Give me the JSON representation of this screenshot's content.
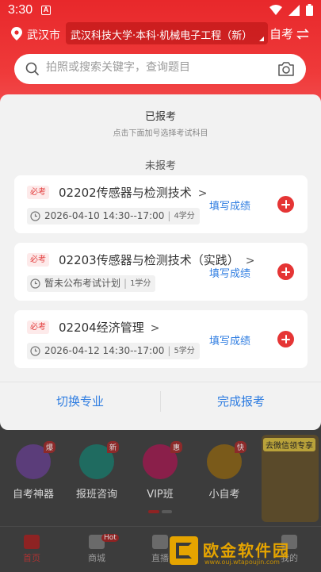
{
  "status_bar": {
    "time": "3:30",
    "a_icon": "A",
    "icons": [
      "wifi-icon",
      "signal-icon",
      "battery-icon"
    ]
  },
  "header": {
    "city": "武汉市",
    "major": "武汉科技大学·本科·机械电子工程（新）",
    "exam_type": "自考",
    "search_placeholder": "拍照或搜索关键字，查询题目"
  },
  "sheet": {
    "registered_title": "已报考",
    "registered_hint": "点击下面加号选择考试科目",
    "unregistered_title": "未报考",
    "courses": [
      {
        "tag": "必考",
        "name": "02202传感器与检测技术",
        "chevron": ">",
        "schedule": "2026-04-10 14:30--17:00",
        "credits": "4学分",
        "fill_label": "填写成绩"
      },
      {
        "tag": "必考",
        "name": "02203传感器与检测技术（实践）",
        "chevron": ">",
        "schedule": "暂未公布考试计划",
        "credits": "1学分",
        "fill_label": "填写成绩"
      },
      {
        "tag": "必考",
        "name": "02204经济管理",
        "chevron": ">",
        "schedule": "2026-04-12 14:30--17:00",
        "credits": "5学分",
        "fill_label": "填写成绩"
      }
    ],
    "switch_major_label": "切换专业",
    "done_label": "完成报考"
  },
  "background": {
    "features": [
      {
        "label": "自考神器",
        "badge": "爆",
        "color": "#5b3d7a"
      },
      {
        "label": "报班咨询",
        "badge": "新",
        "color": "#1f6b60"
      },
      {
        "label": "VIP班",
        "badge": "惠",
        "color": "#8a1f4a"
      },
      {
        "label": "小自考",
        "badge": "快",
        "color": "#7a5a1a"
      }
    ],
    "promo_text": "去微信领专享",
    "nav": [
      {
        "label": "首页",
        "active": true
      },
      {
        "label": "商城",
        "active": false
      },
      {
        "label": "直播",
        "active": false
      },
      {
        "label": "我的",
        "active": false
      }
    ],
    "hot_badge": "Hot"
  },
  "watermark": {
    "title": "欧金软件园",
    "subtitle": "www.ouj.wtapoujin.com"
  },
  "colors": {
    "brand_red": "#e8282b",
    "link_blue": "#2f7de1",
    "add_red": "#e53535"
  }
}
